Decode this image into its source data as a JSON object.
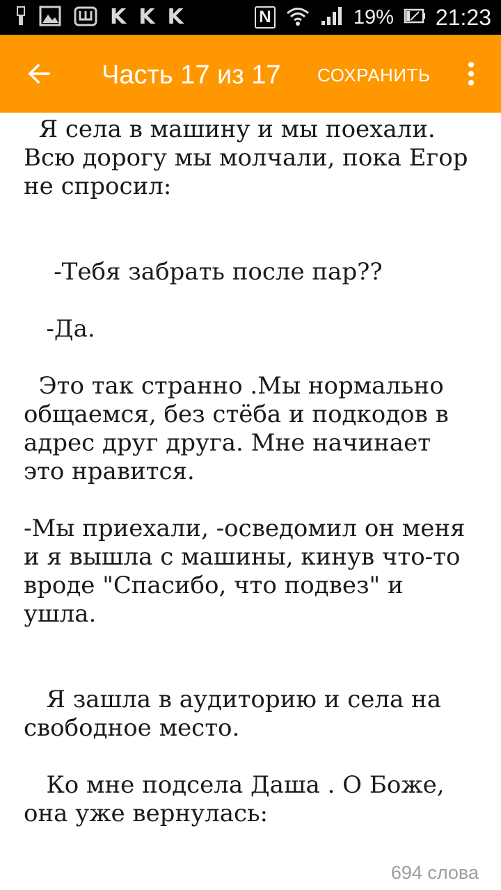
{
  "status_bar": {
    "k_letters": [
      "K",
      "K",
      "K"
    ],
    "nfc_label": "N",
    "battery_percent": "19%",
    "time": "21:23",
    "icons": [
      "usb-icon",
      "image-icon",
      "shop-icon",
      "nfc-icon",
      "wifi-icon",
      "signal-icon",
      "battery-icon"
    ]
  },
  "app_bar": {
    "background": "#ff9800",
    "title": "Часть 17 из 17",
    "save_label": "СОХРАНИТЬ",
    "icons": [
      "back-arrow-icon",
      "more-vertical-icon"
    ]
  },
  "story": {
    "paragraphs": [
      "  Я села в машину и мы поехали. Всю дорогу мы молчали, пока Егор не спросил:",
      "",
      "",
      "    -Тебя забрать после пар??",
      "",
      "   -Да.",
      "",
      "  Это так странно .Мы нормально общаемся, без стёба и подкодов в адрес друг друга. Мне начинает это нравится.",
      "",
      "-Мы приехали, -осведомил он меня и я вышла с машины, кинув что-то вроде \"Спасибо, что подвез\" и ушла.",
      "",
      "",
      "   Я зашла в аудиторию и села на свободное место.",
      "",
      "   Ко мне подсела Даша . О Боже, она уже вернулась:"
    ]
  },
  "footer": {
    "word_count": "694 слова"
  }
}
